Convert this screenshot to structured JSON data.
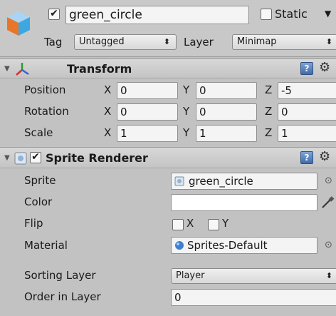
{
  "header": {
    "name": "green_circle",
    "static_label": "Static",
    "static_checked": false,
    "active_checked": true,
    "tag_label": "Tag",
    "tag_value": "Untagged",
    "layer_label": "Layer",
    "layer_value": "Minimap"
  },
  "transform": {
    "title": "Transform",
    "rows": [
      {
        "label": "Position",
        "x": "0",
        "y": "0",
        "z": "-5"
      },
      {
        "label": "Rotation",
        "x": "0",
        "y": "0",
        "z": "0"
      },
      {
        "label": "Scale",
        "x": "1",
        "y": "1",
        "z": "1"
      }
    ],
    "axes": [
      "X",
      "Y",
      "Z"
    ]
  },
  "sprite_renderer": {
    "title": "Sprite Renderer",
    "enabled": true,
    "sprite_label": "Sprite",
    "sprite_value": "green_circle",
    "color_label": "Color",
    "color_value": "#ffffff",
    "flip_label": "Flip",
    "flip_x_label": "X",
    "flip_y_label": "Y",
    "material_label": "Material",
    "material_value": "Sprites-Default",
    "sorting_layer_label": "Sorting Layer",
    "sorting_layer_value": "Player",
    "order_label": "Order in Layer",
    "order_value": "0"
  },
  "icons": {
    "gameobject": "cube-icon",
    "transform": "transform-axes-icon",
    "sprite_renderer": "sprite-renderer-icon",
    "help": "help-icon",
    "settings": "gear-icon",
    "picker": "object-picker-icon",
    "eyedropper": "eyedropper-icon"
  }
}
